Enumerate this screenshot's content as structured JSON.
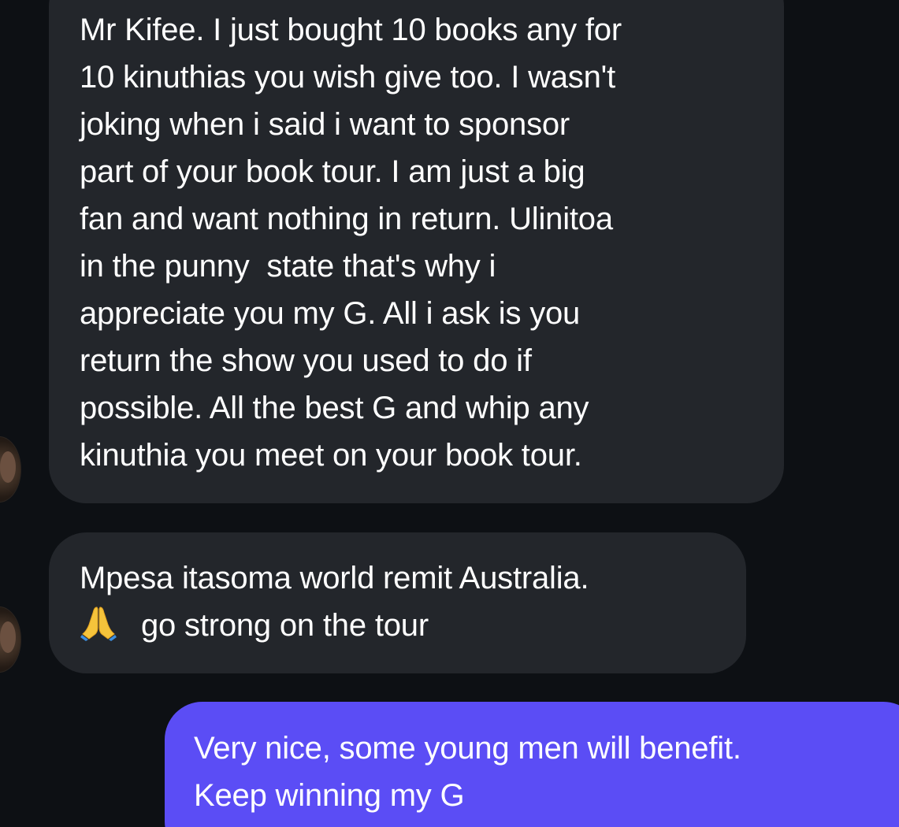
{
  "messages": [
    {
      "direction": "incoming",
      "lines": [
        "Mr Kifee. I just bought 10 books any for",
        "10 kinuthias you wish give too. I wasn't",
        "joking when i said i want to sponsor",
        "part of your book tour. I am just a big",
        "fan and want nothing in return. Ulinitoa",
        "in the punny  state that's why i",
        "appreciate you my G. All i ask is you",
        "return the show you used to do if",
        "possible. All the best G and whip any",
        "kinuthia you meet on your book tour."
      ]
    },
    {
      "direction": "incoming",
      "lines": [
        "Mpesa itasoma world remit Australia.",
        "go strong on the tour"
      ],
      "emoji": "folded-hands"
    },
    {
      "direction": "outgoing",
      "lines": [
        "Very nice, some young men will benefit.",
        "Keep winning my G"
      ]
    }
  ],
  "colors": {
    "background": "#0d1014",
    "incoming_bubble": "#23262b",
    "outgoing_bubble": "#5b4df5",
    "text": "#ffffff"
  },
  "icons": [
    "avatar",
    "folded-hands-emoji"
  ]
}
